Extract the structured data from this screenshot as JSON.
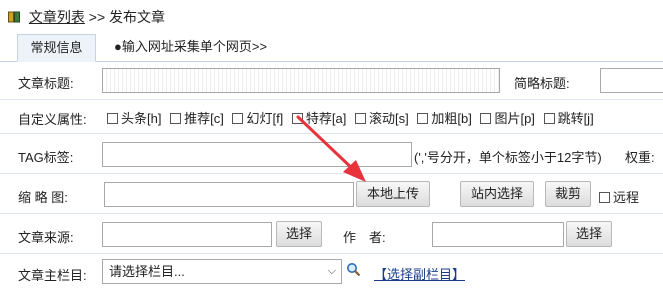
{
  "breadcrumb": {
    "list_label": "文章列表",
    "sep": ">>",
    "current": "发布文章"
  },
  "tabs": [
    {
      "label": "常规信息"
    },
    {
      "label": "●输入网址采集单个网页>>"
    }
  ],
  "fields": {
    "title_label": "文章标题:",
    "short_title_label": "简略标题:",
    "custom_attr_label": "自定义属性:",
    "attrs": [
      "头条[h]",
      "推荐[c]",
      "幻灯[f]",
      "特荐[a]",
      "滚动[s]",
      "加粗[b]",
      "图片[p]",
      "跳转[j]"
    ],
    "tag_label": "TAG标签:",
    "tag_hint": "(','号分开，单个标签小于12字节)",
    "weight_label": "权重:",
    "thumb_label": "缩 略 图:",
    "upload_local": "本地上传",
    "site_select": "站内选择",
    "crop": "裁剪",
    "remote_label": "远程",
    "source_label": "文章来源:",
    "source_select": "选择",
    "author_label": "作　者:",
    "author_select": "选择",
    "column_label": "文章主栏目:",
    "column_placeholder": "请选择栏目...",
    "sub_column_link": "【选择副栏目】"
  },
  "colors": {
    "arrow": "#e8323c",
    "border": "#a9a9a9",
    "tab_bg": "#eef3f9"
  }
}
